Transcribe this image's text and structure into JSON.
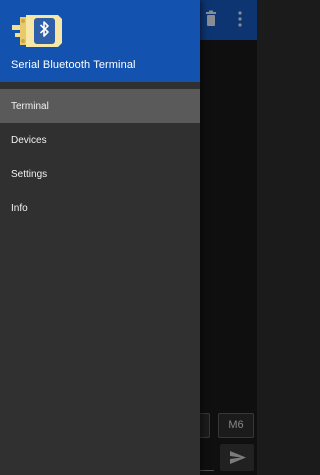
{
  "colors": {
    "appbar": "#1452b0",
    "drawer_background": "#303030",
    "active_item": "#5a5a5a",
    "text": "#f2f2f2"
  },
  "app": {
    "toolbar_actions": [
      "trash-icon",
      "more-vert-icon"
    ],
    "macro_buttons": [
      "",
      "M6"
    ],
    "send_icon": "send-icon"
  },
  "drawer": {
    "logo_icon": "bluetooth-serial-connector-icon",
    "title": "Serial Bluetooth Terminal",
    "items": [
      {
        "label": "Terminal",
        "active": true
      },
      {
        "label": "Devices",
        "active": false
      },
      {
        "label": "Settings",
        "active": false
      },
      {
        "label": "Info",
        "active": false
      }
    ]
  }
}
